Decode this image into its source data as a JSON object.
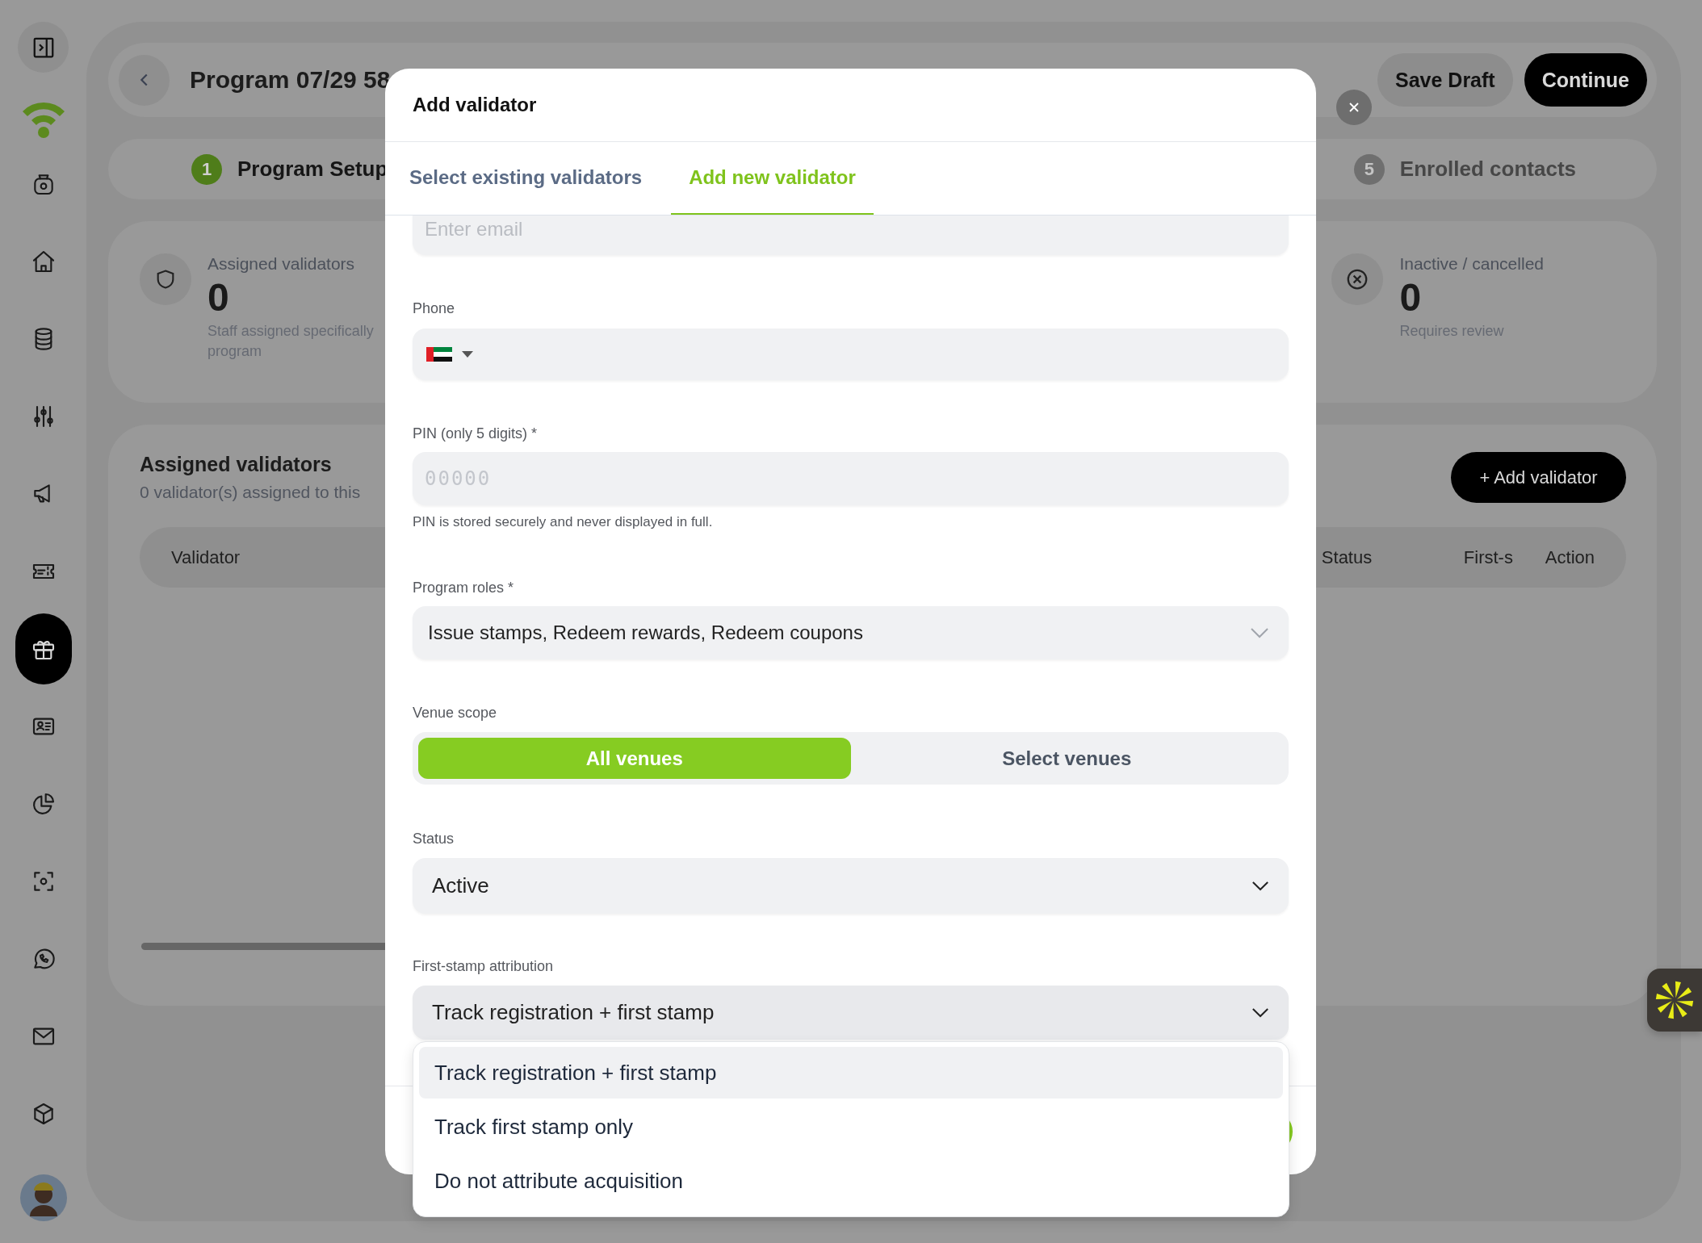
{
  "sidebar": {
    "items": [
      {
        "selected": false
      },
      {
        "selected": false
      },
      {
        "selected": false
      },
      {
        "selected": false
      },
      {
        "selected": false
      },
      {
        "selected": false
      },
      {
        "selected": true
      },
      {
        "selected": false
      },
      {
        "selected": false
      },
      {
        "selected": false
      },
      {
        "selected": false
      },
      {
        "selected": false
      },
      {
        "selected": false
      }
    ]
  },
  "header": {
    "title": "Program 07/29 58",
    "buttons": [
      {
        "label": "Save Draft",
        "kind": "secondary"
      },
      {
        "label": "Continue",
        "kind": "primary"
      }
    ]
  },
  "steps": [
    {
      "number": "1",
      "label": "Program Setup",
      "active": true
    },
    {
      "number": "5",
      "label": "Enrolled contacts",
      "active": false
    }
  ],
  "stats": [
    {
      "kind": "shield",
      "title": "Assigned validators",
      "value": "0",
      "description_lines": [
        "Staff assigned specifically",
        "program"
      ]
    },
    {
      "kind": "cancelled",
      "title": "Inactive / cancelled",
      "value": "0",
      "description_lines": [
        "Requires review"
      ]
    }
  ],
  "validators_section": {
    "title": "Assigned validators",
    "subtitle": "0 validator(s) assigned to this",
    "add_button": "+ Add validator",
    "columns": [
      "Validator",
      "Status",
      "First-s",
      "Action"
    ]
  },
  "modal": {
    "title": "Add validator",
    "tabs": [
      {
        "label": "Select existing validators",
        "selected": false
      },
      {
        "label": "Add new validator",
        "selected": true
      }
    ],
    "email": {
      "placeholder": "Enter email"
    },
    "phone": {
      "label": "Phone"
    },
    "pin": {
      "label": "PIN (only 5 digits) *",
      "placeholder": "00000",
      "hint": "PIN is stored securely and never displayed in full."
    },
    "program_roles": {
      "label": "Program roles *",
      "value": "Issue stamps, Redeem rewards, Redeem coupons"
    },
    "venue_scope": {
      "label": "Venue scope",
      "options": [
        {
          "label": "All venues",
          "selected": true
        },
        {
          "label": "Select venues",
          "selected": false
        }
      ]
    },
    "status": {
      "label": "Status",
      "value": "Active"
    },
    "first_stamp_attribution": {
      "label": "First-stamp attribution",
      "value": "Track registration + first stamp",
      "expanded": true,
      "options": [
        {
          "label": "Track registration + first stamp",
          "selected": true
        },
        {
          "label": "Track first stamp only",
          "selected": false
        },
        {
          "label": "Do not attribute acquisition",
          "selected": false
        }
      ]
    }
  }
}
